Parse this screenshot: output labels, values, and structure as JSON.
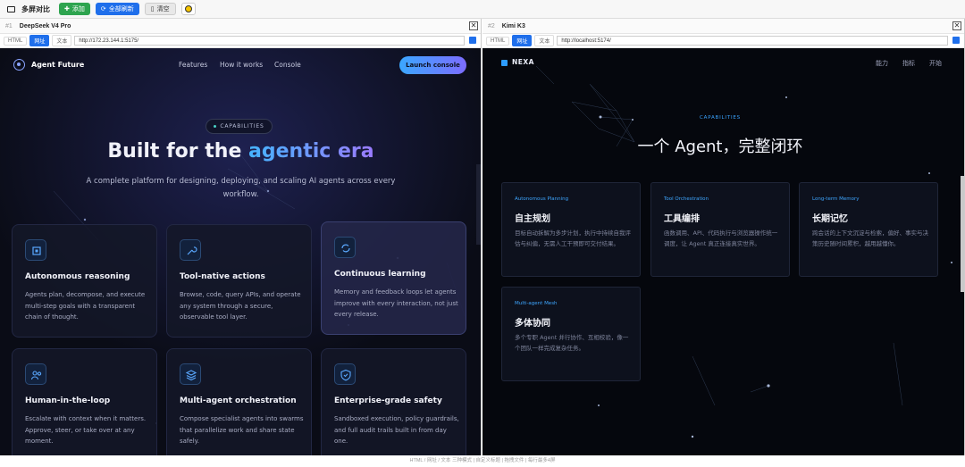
{
  "toolbar": {
    "app_title": "多屏对比",
    "add_label": "添加",
    "refresh_all_label": "全部刷新",
    "clear_label": "清空"
  },
  "left_pane": {
    "index": "#1",
    "title": "DeepSeek V4 Pro",
    "modes": [
      "HTML",
      "网址",
      "文本"
    ],
    "url": "http://172.23.144.1:5175/",
    "site": {
      "brand": "Agent Future",
      "nav": [
        "Features",
        "How it works",
        "Console"
      ],
      "cta": "Launch console",
      "chip": "CAPABILITIES",
      "hero_a": "Built for the ",
      "hero_b": "agentic era",
      "subtitle": "A complete platform for designing, deploying, and scaling AI agents across every workflow.",
      "cards": [
        {
          "title": "Autonomous reasoning",
          "desc": "Agents plan, decompose, and execute multi-step goals with a transparent chain of thought.",
          "icon": "chip-icon"
        },
        {
          "title": "Tool-native actions",
          "desc": "Browse, code, query APIs, and operate any system through a secure, observable tool layer.",
          "icon": "wrench-icon"
        },
        {
          "title": "Continuous learning",
          "desc": "Memory and feedback loops let agents improve with every interaction, not just every release.",
          "icon": "refresh-icon"
        },
        {
          "title": "Human-in-the-loop",
          "desc": "Escalate with context when it matters. Approve, steer, or take over at any moment.",
          "icon": "users-icon"
        },
        {
          "title": "Multi-agent orchestration",
          "desc": "Compose specialist agents into swarms that parallelize work and share state safely.",
          "icon": "layers-icon"
        },
        {
          "title": "Enterprise-grade safety",
          "desc": "Sandboxed execution, policy guardrails, and full audit trails built in from day one.",
          "icon": "shield-icon"
        }
      ]
    }
  },
  "right_pane": {
    "index": "#2",
    "title": "Kimi K3",
    "modes": [
      "HTML",
      "网址",
      "文本"
    ],
    "url": "http://localhost:5174/",
    "site": {
      "brand": "NEXA",
      "nav": [
        "能力",
        "指标",
        "开始"
      ],
      "cap": "CAPABILITIES",
      "hero": "一个 Agent，完整闭环",
      "cards": [
        {
          "tag": "Autonomous Planning",
          "title": "自主规划",
          "desc": "目标自动拆解为多步计划，执行中持续自我评估与纠偏，无需人工干预即可交付结果。"
        },
        {
          "tag": "Tool Orchestration",
          "title": "工具编排",
          "desc": "函数调用、API、代码执行与浏览器操作统一调度，让 Agent 真正连接真实世界。"
        },
        {
          "tag": "Long-term Memory",
          "title": "长期记忆",
          "desc": "跨会话的上下文沉淀与检索，偏好、事实与决策历史随时间累积，越用越懂你。"
        },
        {
          "tag": "Multi-agent Mesh",
          "title": "多体协同",
          "desc": "多个专职 Agent 并行协作、互相校验，像一个团队一样完成复杂任务。"
        }
      ]
    }
  },
  "footer": "HTML / 网址 / 文本 三种模式 | 自定义标题 | 拖拽文件 | 每行最多4屏"
}
